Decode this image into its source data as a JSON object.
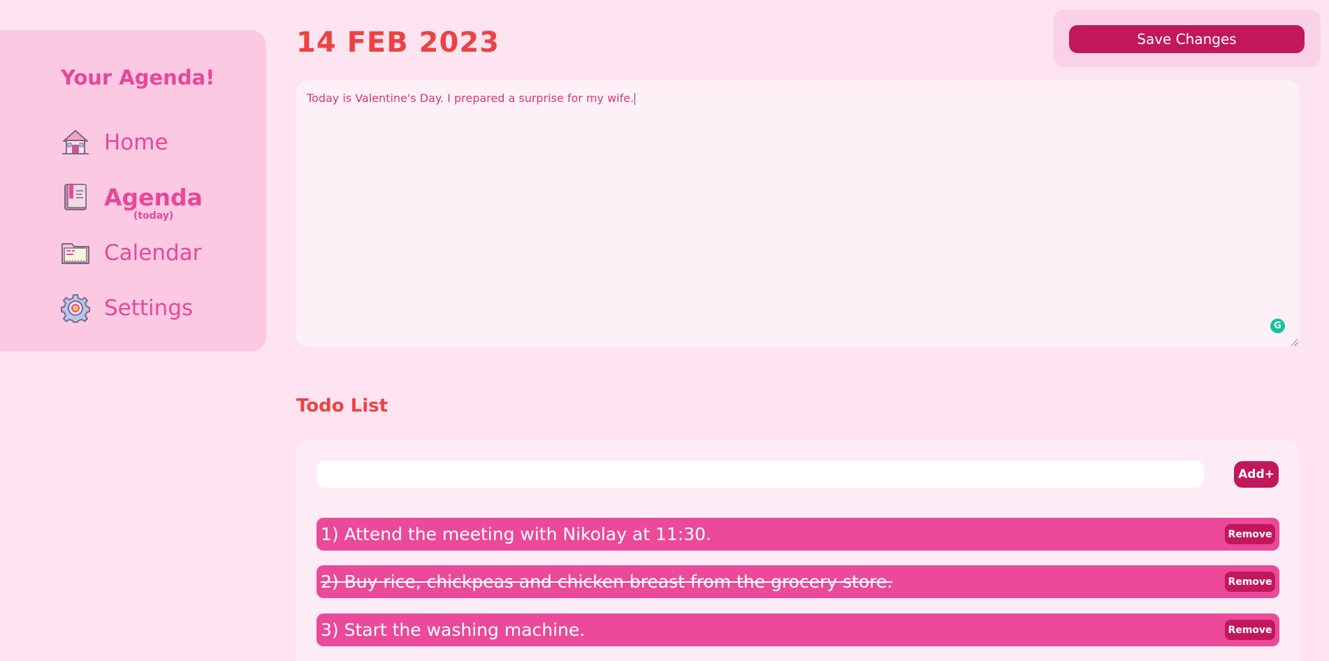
{
  "sidebar": {
    "brand": "Your Agenda!",
    "items": [
      {
        "label": "Home",
        "icon": "house-icon"
      },
      {
        "label": "Agenda",
        "sub": "(today)",
        "icon": "notebook-icon"
      },
      {
        "label": "Calendar",
        "icon": "folder-icon"
      },
      {
        "label": "Settings",
        "icon": "gear-icon"
      }
    ]
  },
  "header": {
    "date": "14 FEB 2023",
    "save_label": "Save Changes"
  },
  "notes": {
    "text": "Today is Valentine's Day. I prepared a surprise for my wife.",
    "grammarly_icon": "grammarly-icon"
  },
  "todo": {
    "title": "Todo List",
    "input_value": "",
    "add_label": "Add+",
    "remove_label": "Remove",
    "items": [
      {
        "text": "1) Attend the meeting with Nikolay at 11:30.",
        "done": false
      },
      {
        "text": "2) Buy rice, chickpeas and chicken breast from the grocery store.",
        "done": true
      },
      {
        "text": "3) Start the washing machine.",
        "done": false
      }
    ]
  },
  "colors": {
    "background": "#fde4f0",
    "sidebar": "#fbc9e2",
    "accent_pink": "#e8479a",
    "accent_red": "#ee4242",
    "button": "#c2185b",
    "todo_item": "#ea4a99"
  }
}
